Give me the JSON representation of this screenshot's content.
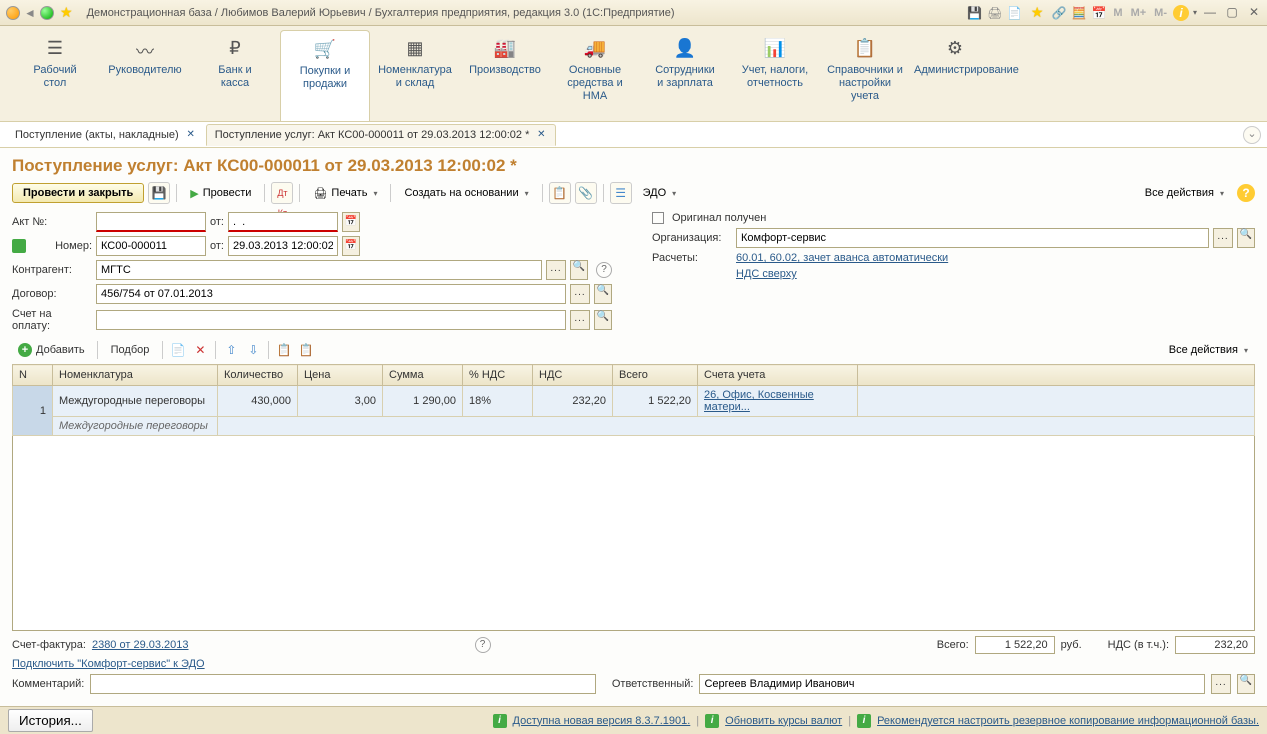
{
  "titlebar": {
    "title": "Демонстрационная база / Любимов Валерий Юрьевич / Бухгалтерия предприятия, редакция 3.0  (1С:Предприятие)",
    "m1": "M",
    "m2": "M+",
    "m3": "M-"
  },
  "ribbon": [
    {
      "label": "Рабочий\nстол",
      "icon": "☰"
    },
    {
      "label": "Руководителю",
      "icon": "〰"
    },
    {
      "label": "Банк и\nкасса",
      "icon": "₽"
    },
    {
      "label": "Покупки и\nпродажи",
      "icon": "🛒"
    },
    {
      "label": "Номенклатура\nи склад",
      "icon": "▦"
    },
    {
      "label": "Производство",
      "icon": "🏭"
    },
    {
      "label": "Основные\nсредства и НМА",
      "icon": "🚚"
    },
    {
      "label": "Сотрудники\nи зарплата",
      "icon": "👤"
    },
    {
      "label": "Учет, налоги,\nотчетность",
      "icon": "📊"
    },
    {
      "label": "Справочники и\nнастройки учета",
      "icon": "📋"
    },
    {
      "label": "Администрирование",
      "icon": "⚙"
    }
  ],
  "tabs": [
    {
      "label": "Поступление (акты, накладные)",
      "active": false
    },
    {
      "label": "Поступление услуг: Акт КС00-000011 от 29.03.2013 12:00:02 *",
      "active": true
    }
  ],
  "doc_title": "Поступление услуг: Акт КС00-000011 от 29.03.2013 12:00:02 *",
  "toolbar": {
    "main": "Провести и закрыть",
    "post": "Провести",
    "print": "Печать",
    "create": "Создать на основании",
    "edo": "ЭДО",
    "all_actions": "Все действия"
  },
  "form": {
    "akt_label": "Акт №:",
    "akt_value": "",
    "akt_ot": "от:",
    "akt_date": ".  .",
    "num_label": "Номер:",
    "num_value": "КС00-000011",
    "num_ot": "от:",
    "num_date": "29.03.2013 12:00:02",
    "counterparty_label": "Контрагент:",
    "counterparty": "МГТС",
    "contract_label": "Договор:",
    "contract": "456/754 от 07.01.2013",
    "invoice_label": "Счет на оплату:",
    "invoice": "",
    "original_label": "Оригинал получен",
    "org_label": "Организация:",
    "org": "Комфорт-сервис",
    "calc_label": "Расчеты:",
    "calc_link": "60.01, 60.02, зачет аванса автоматически",
    "vat_link": "НДС сверху"
  },
  "table_tb": {
    "add": "Добавить",
    "select": "Подбор",
    "all_actions": "Все действия"
  },
  "columns": {
    "n": "N",
    "nomenclature": "Номенклатура",
    "qty": "Количество",
    "price": "Цена",
    "sum": "Сумма",
    "vat_pct": "% НДС",
    "vat": "НДС",
    "total": "Всего",
    "accounts": "Счета учета"
  },
  "rows": [
    {
      "n": "1",
      "nomenclature": "Междугородные переговоры",
      "nomenclature2": "Междугородные переговоры",
      "qty": "430,000",
      "price": "3,00",
      "sum": "1 290,00",
      "vat_pct": "18%",
      "vat": "232,20",
      "total": "1 522,20",
      "accounts": "26, Офис, Косвенные матери..."
    }
  ],
  "footer": {
    "invoice_fact_label": "Счет-фактура:",
    "invoice_fact_link": "2380 от 29.03.2013",
    "edo_link": "Подключить \"Комфорт-сервис\" к ЭДО",
    "total_label": "Всего:",
    "total_value": "1 522,20",
    "rub": "руб.",
    "vat_label": "НДС (в т.ч.):",
    "vat_value": "232,20",
    "comment_label": "Комментарий:",
    "comment": "",
    "responsible_label": "Ответственный:",
    "responsible": "Сергеев Владимир Иванович"
  },
  "statusbar": {
    "history": "История...",
    "s1": "Доступна новая версия 8.3.7.1901.",
    "s2": "Обновить курсы валют",
    "s3": "Рекомендуется настроить резервное копирование информационной базы."
  }
}
